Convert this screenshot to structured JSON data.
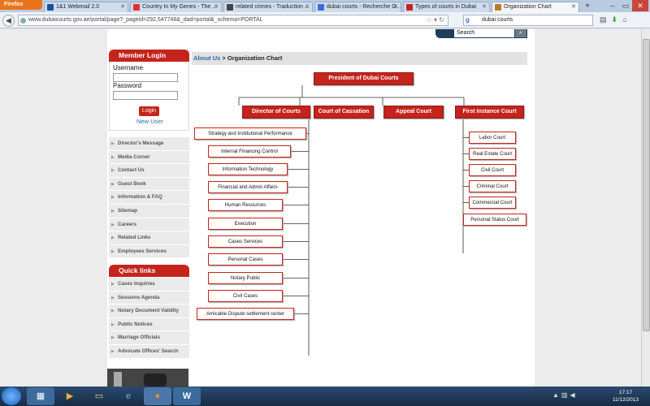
{
  "browser": {
    "app_button": "Firefox",
    "tabs": [
      {
        "title": "1&1 Webmail 2.0",
        "favicon_color": "#1c4f9c"
      },
      {
        "title": "Country In My Genes - The ...",
        "favicon_color": "#d33"
      },
      {
        "title": "related crimes - Traduction ...",
        "favicon_color": "#444"
      },
      {
        "title": "dubai courts - Recherche G...",
        "favicon_color": "#3a6fd8"
      },
      {
        "title": "Types of courts in Dubai",
        "favicon_color": "#c4241c"
      },
      {
        "title": "Organization Chart",
        "favicon_color": "#b73"
      }
    ],
    "new_tab": "+",
    "url": "www.dubaicourts.gov.ae/portal/page?_pageid=292,547748&_dad=portal&_schema=PORTAL",
    "search_value": "dubai courts"
  },
  "site": {
    "search_label": "Search",
    "member_login": {
      "title": "Member Login",
      "username_label": "Username",
      "password_label": "Password",
      "login_button": "Login",
      "new_user": "New User"
    },
    "menu": [
      "Director's Message",
      "Media Corner",
      "Contact Us",
      "Guest Book",
      "Information & FAQ",
      "Sitemap",
      "Careers",
      "Related Links",
      "Employees Services"
    ],
    "quick_links_title": "Quick links",
    "quick_links": [
      "Cases Inquiries",
      "Sessions Agenda",
      "Notary Document Validity",
      "Public Notices",
      "Marriage Officials",
      "Advocate Offices' Search"
    ],
    "breadcrumb": {
      "link": "About Us",
      "separator": " > ",
      "current": "Organization Chart"
    }
  },
  "org_chart": {
    "president": "President of Dubai Courts",
    "branches": [
      "Director of Courts",
      "Court of Cassation",
      "Appeal Court",
      "First Instance Court"
    ],
    "director_units": [
      "Strategy and Institutional Performance",
      "Internal Financing Control",
      "Information Technology",
      "Financial and Admin Affairs",
      "Human Resources",
      "Execution",
      "Cases Services",
      "Personal Cases",
      "Notary Public",
      "Civil Cases",
      "Amicable Dispute settlement center"
    ],
    "first_instance_courts": [
      "Labor Court",
      "Real Estate Court",
      "Civil Court",
      "Criminal Court",
      "Commercial Court",
      "Personal Status Court"
    ]
  },
  "taskbar": {
    "time": "17:17",
    "date": "11/12/2013"
  }
}
